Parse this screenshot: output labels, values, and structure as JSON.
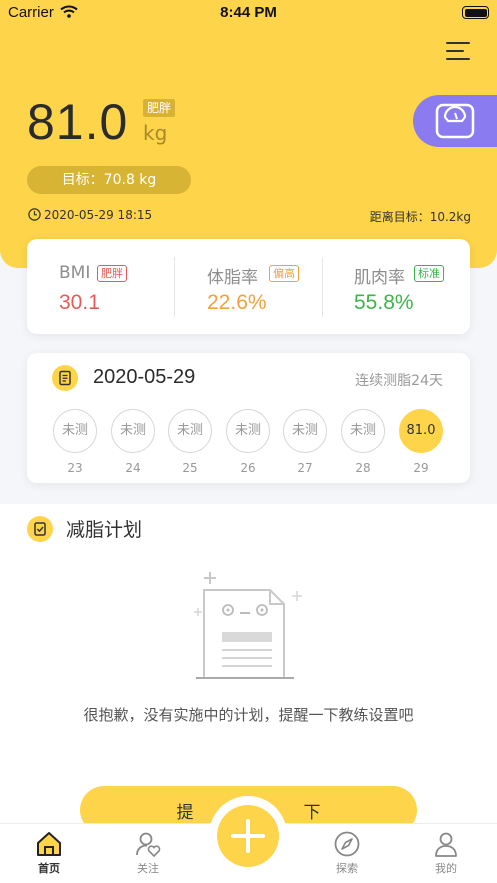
{
  "status_bar": {
    "carrier": "Carrier",
    "time": "8:44 PM"
  },
  "header": {
    "weight": "81.0",
    "weight_status": "肥胖",
    "unit": "kg",
    "target": "目标：70.8 kg",
    "measured_at": "2020-05-29 18:15",
    "distance_to_target": "距离目标：10.2kg"
  },
  "metrics": {
    "bmi": {
      "label": "BMI",
      "badge": "肥胖",
      "value": "30.1",
      "color": "#e85a5a"
    },
    "body_fat": {
      "label": "体脂率",
      "badge": "偏高",
      "value": "22.6%",
      "color": "#f0a23b"
    },
    "muscle": {
      "label": "肌肉率",
      "badge": "标准",
      "value": "55.8%",
      "color": "#3cb54a"
    }
  },
  "streak": {
    "date": "2020-05-29",
    "days_text": "连续测脂24天",
    "days": [
      {
        "value": "未测",
        "day": "23",
        "active": false
      },
      {
        "value": "未测",
        "day": "24",
        "active": false
      },
      {
        "value": "未测",
        "day": "25",
        "active": false
      },
      {
        "value": "未测",
        "day": "26",
        "active": false
      },
      {
        "value": "未测",
        "day": "27",
        "active": false
      },
      {
        "value": "未测",
        "day": "28",
        "active": false
      },
      {
        "value": "81.0",
        "day": "29",
        "active": true
      }
    ]
  },
  "plan": {
    "title": "减脂计划",
    "empty_text": "很抱歉，没有实施中的计划，提醒一下教练设置吧",
    "button_left": "提",
    "button_right": "下"
  },
  "tabs": [
    {
      "label": "首页",
      "icon": "home-icon",
      "active": true
    },
    {
      "label": "关注",
      "icon": "follow-icon",
      "active": false
    },
    {
      "label": "探索",
      "icon": "compass-icon",
      "active": false
    },
    {
      "label": "我的",
      "icon": "profile-icon",
      "active": false
    }
  ],
  "colors": {
    "accent": "#fdd44a",
    "scale_button": "#8b7bf0"
  }
}
